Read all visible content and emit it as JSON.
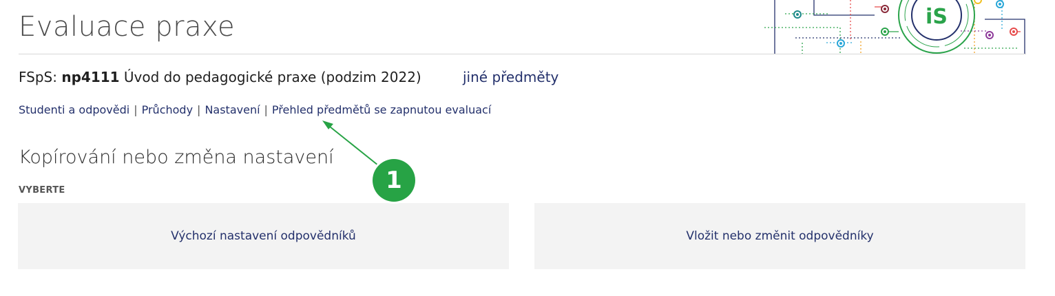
{
  "header": {
    "title": "Evaluace praxe",
    "logo_text": "iS"
  },
  "course": {
    "faculty": "FSpS:",
    "code": "np4111",
    "name": "Úvod do pedagogické praxe (podzim 2022)",
    "other_subjects": "jiné předměty"
  },
  "nav": {
    "items": [
      {
        "label": "Studenti a odpovědi"
      },
      {
        "label": "Průchody"
      },
      {
        "label": "Nastavení"
      },
      {
        "label": "Přehled předmětů se zapnutou evaluací"
      }
    ],
    "separator": "|"
  },
  "section": {
    "heading": "Kopírování nebo změna nastavení",
    "select_label": "VYBERTE",
    "choices": [
      {
        "label": "Výchozí nastavení odpovědníků"
      },
      {
        "label": "Vložit nebo změnit odpovědníky"
      }
    ]
  },
  "annotation": {
    "badge_number": "1",
    "color": "#27a345"
  },
  "colors": {
    "link": "#23306b",
    "panel": "#f3f3f3",
    "logo_green": "#2aa34a",
    "logo_navy": "#23306b"
  }
}
